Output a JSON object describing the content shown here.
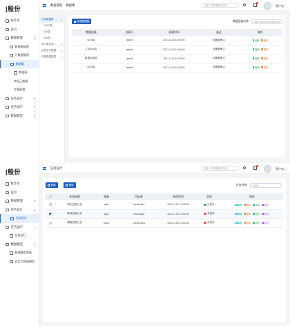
{
  "app": {
    "logo": "|般份",
    "username": "用户名",
    "search_placeholder": "搜索人员数据库的名称"
  },
  "screen1": {
    "breadcrumb": [
      "数据管理",
      "数据集"
    ],
    "menu": [
      {
        "label": "统计页",
        "level": 0
      },
      {
        "label": "首页",
        "level": 0
      },
      {
        "label": "数据管理",
        "level": 0,
        "arrow": "▲"
      },
      {
        "label": "数据源管理",
        "level": 1
      },
      {
        "label": "元数据管理",
        "level": 1
      },
      {
        "label": "数据集",
        "level": 1,
        "active": true
      },
      {
        "label": "数据表",
        "level": 2
      },
      {
        "label": "字段元数据",
        "level": 3
      },
      {
        "label": "字典配置",
        "level": 3
      },
      {
        "label": "任务设计",
        "level": 0,
        "arrow": "▼"
      },
      {
        "label": "任务运行",
        "level": 0,
        "arrow": "▼"
      },
      {
        "label": "数据模型",
        "level": 0,
        "arrow": "▼"
      }
    ],
    "tree": [
      {
        "label": "已有数据集",
        "selected": true,
        "arrow": "▲"
      },
      {
        "label": "ODS层",
        "child": true
      },
      {
        "label": "DW层",
        "child": true
      },
      {
        "label": "DM层",
        "child": true
      },
      {
        "label": "学习委员会...",
        "arrow": "▼"
      },
      {
        "label": "综合学习数据",
        "arrow": "▼"
      },
      {
        "label": "内部数据数据",
        "arrow": "▼"
      }
    ],
    "new_button": "新建数据集",
    "filter_label": "数据层级名称:",
    "filter_placeholder": "请输入要搜索的数据集名称",
    "columns": [
      "数据层级",
      "创建人",
      "创建时间",
      "备注",
      "操作"
    ],
    "rows": [
      [
        "ODS层",
        "admin",
        "2021-0-15 15:00:00",
        "设置数备注"
      ],
      [
        "汇总DW层",
        "admin",
        "2021-0-15 15:00:00",
        "设置数备注"
      ],
      [
        "数据应用层",
        "admin",
        "2021-0-15 15:00:00",
        "设置数备注"
      ],
      [
        "ODS层",
        "admin",
        "2021-0-15 15:00:00",
        "设置数备注"
      ]
    ],
    "ops": [
      "编辑",
      "删除"
    ]
  },
  "screen2": {
    "breadcrumb": [
      "任务设计"
    ],
    "menu": [
      {
        "label": "统计页",
        "level": 0
      },
      {
        "label": "首页",
        "level": 0
      },
      {
        "label": "数据管理",
        "level": 0,
        "arrow": "▼"
      },
      {
        "label": "任务设计",
        "level": 0,
        "arrow": "▲"
      },
      {
        "label": "任务设计",
        "level": 1,
        "active": true
      },
      {
        "label": "任务运行",
        "level": 0,
        "arrow": "▼"
      },
      {
        "label": "任务运行",
        "level": 1
      },
      {
        "label": "数据模型",
        "level": 0,
        "arrow": "▲"
      },
      {
        "label": "数据模型审核",
        "level": 1
      },
      {
        "label": "自定义数据模型",
        "level": 1
      }
    ],
    "add_button": "新增",
    "delete_button": "删除",
    "filter_label": "任务名称:",
    "filter_placeholder": "请输入...",
    "columns": [
      "",
      "任务标题",
      "源表",
      "目标表",
      "修改时间",
      "状态",
      "操作"
    ],
    "rows": [
      {
        "checked": false,
        "title": "学生信息汇总",
        "src": "aata",
        "dst": "result aata",
        "time": "2021-0-15 15:00:00",
        "status": "已发布",
        "state": "run"
      },
      {
        "checked": true,
        "title": "教师信息汇总",
        "src": "kacj",
        "dst": "result kacj",
        "time": "2021-0-15 15:00:00",
        "status": "未发布",
        "state": "stop"
      },
      {
        "checked": false,
        "title": "课程信息汇总",
        "src": "kaoa",
        "dst": "result kaoa",
        "time": "2021-0-15 15:00:00",
        "status": "未发布",
        "state": "stop"
      }
    ],
    "ops": [
      "编辑",
      "删除",
      "发布",
      "导出"
    ]
  }
}
